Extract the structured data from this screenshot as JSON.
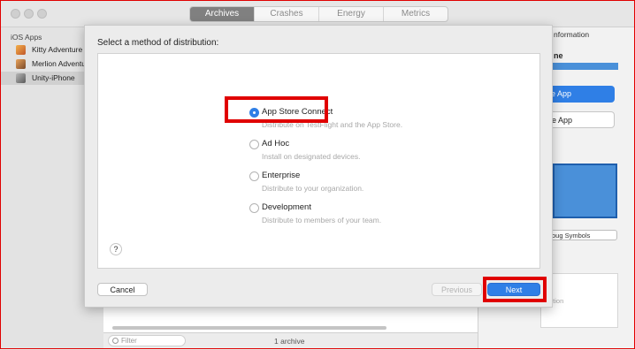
{
  "window": {
    "tabs": [
      {
        "label": "Archives",
        "active": true
      },
      {
        "label": "Crashes",
        "active": false
      },
      {
        "label": "Energy",
        "active": false
      },
      {
        "label": "Metrics",
        "active": false
      }
    ]
  },
  "sidebar": {
    "heading": "iOS Apps",
    "items": [
      {
        "label": "Kitty Adventure",
        "icon": "kitty-app-icon"
      },
      {
        "label": "Merlion Adventure",
        "icon": "merlion-app-icon"
      },
      {
        "label": "Unity-iPhone",
        "icon": "unity-app-icon",
        "selected": true
      }
    ]
  },
  "inspector": {
    "title": "nformation",
    "name": "ne",
    "primary_button": "e App",
    "secondary_button": "e App",
    "debug_button": "oug Symbols",
    "panel_text": "ption"
  },
  "sheet": {
    "title": "Select a method of distribution:",
    "options": [
      {
        "title": "App Store Connect",
        "description": "Distribute on TestFlight and the App Store.",
        "selected": true
      },
      {
        "title": "Ad Hoc",
        "description": "Install on designated devices.",
        "selected": false
      },
      {
        "title": "Enterprise",
        "description": "Distribute to your organization.",
        "selected": false
      },
      {
        "title": "Development",
        "description": "Distribute to members of your team.",
        "selected": false
      }
    ],
    "help_label": "?",
    "buttons": {
      "cancel": "Cancel",
      "previous": "Previous",
      "next": "Next"
    }
  },
  "footer": {
    "filter_placeholder": "Filter",
    "archive_count": "1 archive"
  },
  "colors": {
    "accent": "#2f7fe6",
    "highlight": "#e00000"
  }
}
